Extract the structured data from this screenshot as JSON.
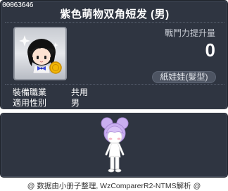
{
  "tooltip": {
    "item_id": "00063646",
    "title": "紫色萌物双角短发 (男)",
    "attack_increase_label": "戰鬥力提升量",
    "attack_increase_value": "0",
    "category": "紙娃娃(髮型)",
    "requirements": [
      {
        "label": "裝備職業",
        "value": "共用"
      },
      {
        "label": "適用性別",
        "value": "男"
      }
    ]
  },
  "footer": {
    "text": "@ 数据由小册子整理, WzComparerR2-NTMS解析 @"
  },
  "colors": {
    "panel_bg": "#2f3541",
    "hair": "#c9aef0",
    "coin": "#f2b705"
  }
}
